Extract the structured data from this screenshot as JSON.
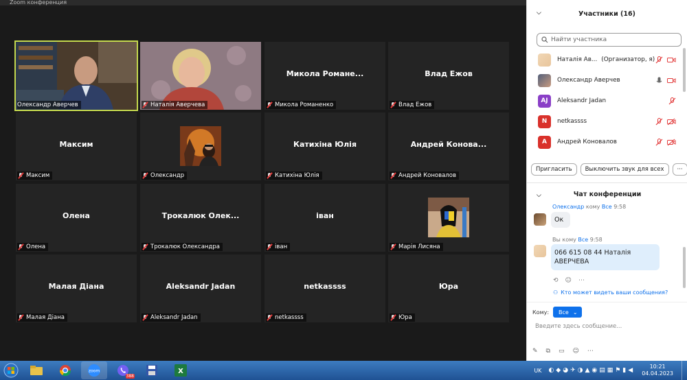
{
  "window": {
    "title": "Zoom конференция"
  },
  "tiles": [
    {
      "name": "Олександр Аверчев",
      "label": "Олександр Аверчев",
      "type": "video-man",
      "muted": false
    },
    {
      "name": "Наталія Аверчева",
      "label": "Наталія Аверчева",
      "type": "video-woman",
      "muted": true
    },
    {
      "name": "Микола  Романе...",
      "label": "Микола Романенко",
      "type": "name",
      "muted": true
    },
    {
      "name": "Влад Ежов",
      "label": "Влад Ежов",
      "type": "name",
      "muted": true
    },
    {
      "name": "Максим",
      "label": "Максим",
      "type": "name",
      "muted": true
    },
    {
      "name": "",
      "label": "Олександр",
      "type": "avatar-fire",
      "muted": true
    },
    {
      "name": "Катихіна Юлія",
      "label": "Катихіна Юлія",
      "type": "name",
      "muted": true
    },
    {
      "name": "Андрей  Конова...",
      "label": "Андрей Коновалов",
      "type": "name",
      "muted": true
    },
    {
      "name": "Олена",
      "label": "Олена",
      "type": "name",
      "muted": true
    },
    {
      "name": "Трокалюк  Олек...",
      "label": "Трокалюк Олександра",
      "type": "name",
      "muted": true
    },
    {
      "name": "іван",
      "label": "іван",
      "type": "name",
      "muted": true
    },
    {
      "name": "",
      "label": "Марія Лисяна",
      "type": "avatar-art",
      "muted": true
    },
    {
      "name": "Малая Діана",
      "label": "Малая Діана",
      "type": "name",
      "muted": true
    },
    {
      "name": "Aleksandr Jadan",
      "label": "Aleksandr Jadan",
      "type": "name",
      "muted": true
    },
    {
      "name": "netkassss",
      "label": "netkassss",
      "type": "name",
      "muted": true
    },
    {
      "name": "Юра",
      "label": "Юра",
      "type": "name",
      "muted": true
    }
  ],
  "participants": {
    "title": "Участники (16)",
    "search_placeholder": "Найти участника",
    "list": [
      {
        "name": "Наталія Ав...",
        "role": "(Организатор, я)",
        "avatar": "photo-woman"
      },
      {
        "name": "Олександр Аверчев",
        "role": "",
        "avatar": "photo-man"
      },
      {
        "name": "Aleksandr Jadan",
        "role": "",
        "avatar": "AJ",
        "color": "#8a3fc7"
      },
      {
        "name": "netkassss",
        "role": "",
        "avatar": "N",
        "color": "#d9312b"
      },
      {
        "name": "Андрей Коновалов",
        "role": "",
        "avatar": "A",
        "color": "#d9312b"
      }
    ],
    "invite_label": "Пригласить",
    "mute_all_label": "Выключить звук для всех",
    "more_label": "···"
  },
  "chat": {
    "title": "Чат конференции",
    "messages": [
      {
        "from": "Олександр",
        "to_word": "кому",
        "to": "Все",
        "time": "9:58",
        "text": "Ок"
      },
      {
        "from": "Вы",
        "to_word": "кому",
        "to": "Все",
        "time": "9:58",
        "text": "066 615 08 44 Наталія АВЕРЧЕВА"
      }
    ],
    "who_can_see": "Кто может видеть ваши сообщения?",
    "to_label": "Кому:",
    "to_value": "Все",
    "input_placeholder": "Введите здесь сообщение..."
  },
  "taskbar": {
    "lang": "UK",
    "time": "10:21",
    "date": "04.04.2023",
    "viber_badge": "388"
  },
  "colors": {
    "active_border": "#c4d84e",
    "accent": "#0e71eb",
    "muted_red": "#e23b3b"
  }
}
